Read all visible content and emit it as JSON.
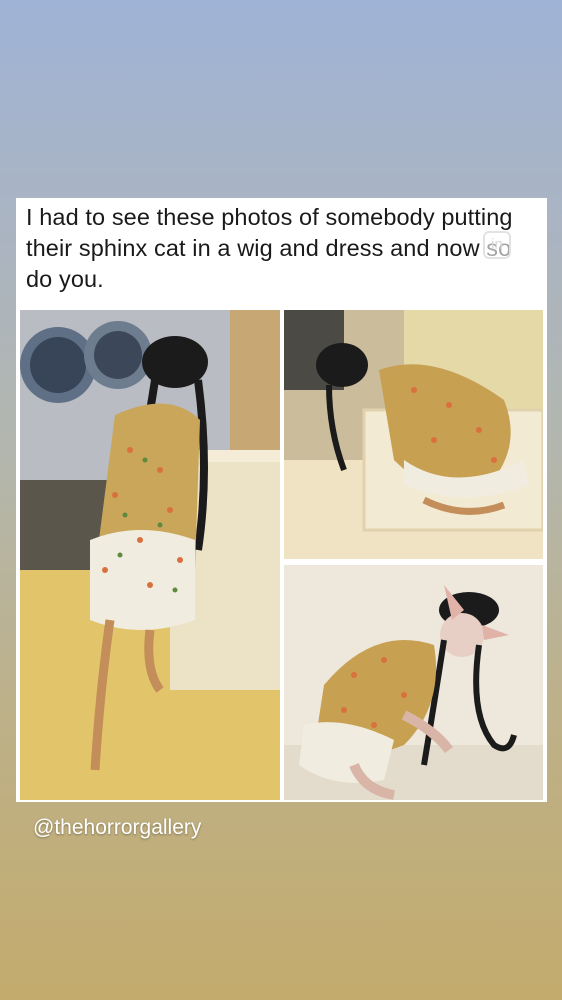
{
  "post": {
    "caption": "I had to see these photos of somebody putting their sphinx cat in a wig and dress and now so do you.",
    "sticker_icon": "instagram-logo-icon",
    "sticker_glyph": "in"
  },
  "photos": [
    {
      "name": "cat-photo-laundry-room"
    },
    {
      "name": "cat-photo-cat-tree"
    },
    {
      "name": "cat-photo-floor"
    }
  ],
  "overlay": {
    "handle": "@thehorrorgallery"
  },
  "colors": {
    "background_top": "#9fb3d6",
    "background_bottom": "#c3ab6d",
    "card": "#ffffff",
    "handle_text": "#ffffff"
  }
}
